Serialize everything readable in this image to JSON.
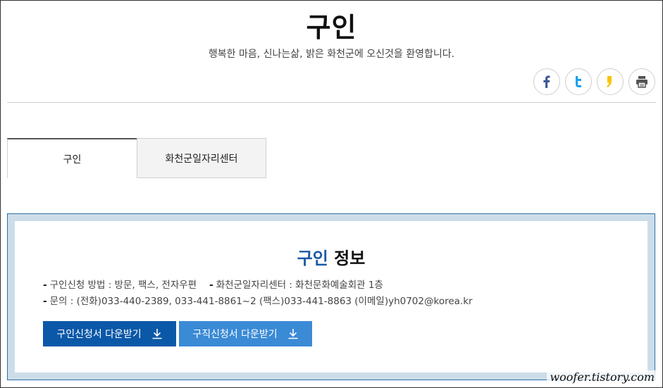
{
  "header": {
    "title": "구인",
    "subtitle": "행복한 마음, 신나는삶, 밝은 화천군에 오신것을 환영합니다."
  },
  "share": [
    {
      "name": "facebook-icon",
      "color": "#3b5998"
    },
    {
      "name": "twitter-icon",
      "color": "#1da1f2"
    },
    {
      "name": "kakaostory-icon",
      "color": "#f7c400"
    },
    {
      "name": "print-icon",
      "color": "#555555"
    }
  ],
  "tabs": [
    {
      "label": "구인",
      "active": true
    },
    {
      "label": "화천군일자리센터",
      "active": false
    }
  ],
  "info": {
    "title_accent": "구인",
    "title_rest": "정보",
    "line1_a": "구인신청 방법 : 방문, 팩스, 전자우편",
    "line1_b": "화천군일자리센터 : 화천문화예술회관 1층",
    "line2": "문의 : (전화)033-440-2389, 033-441-8861~2 (팩스)033-441-8863 (이메일)yh0702@korea.kr",
    "buttons": [
      {
        "label": "구인신청서 다운받기"
      },
      {
        "label": "구직신청서 다운받기"
      }
    ]
  },
  "watermark": "woofer.tistory.com",
  "colors": {
    "accent": "#1a5aa6",
    "button_primary": "#0b58a8",
    "button_secondary": "#3a8ad6",
    "panel_bg": "#ccdde9"
  }
}
